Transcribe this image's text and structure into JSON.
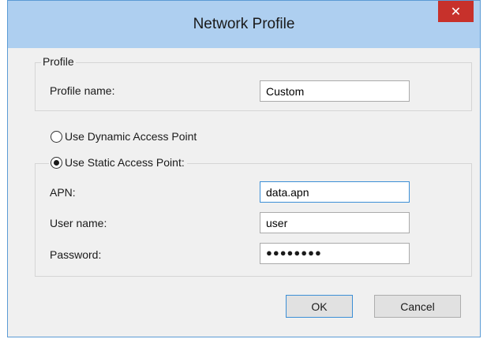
{
  "window": {
    "title": "Network Profile",
    "close_symbol": "✕"
  },
  "profile_group": {
    "label": "Profile",
    "name_label": "Profile name:",
    "name_value": "Custom"
  },
  "access_point": {
    "dynamic_label": "Use Dynamic Access Point",
    "dynamic_selected": false,
    "static_label": "Use Static Access Point:",
    "static_selected": true,
    "apn_label": "APN:",
    "apn_value": "data.apn",
    "user_label": "User name:",
    "user_value": "user",
    "password_label": "Password:",
    "password_value": "●●●●●●●●"
  },
  "buttons": {
    "ok": "OK",
    "cancel": "Cancel"
  },
  "colors": {
    "titlebar": "#aecff0",
    "close_button": "#c7312b",
    "focus_border": "#3c8fd6"
  }
}
